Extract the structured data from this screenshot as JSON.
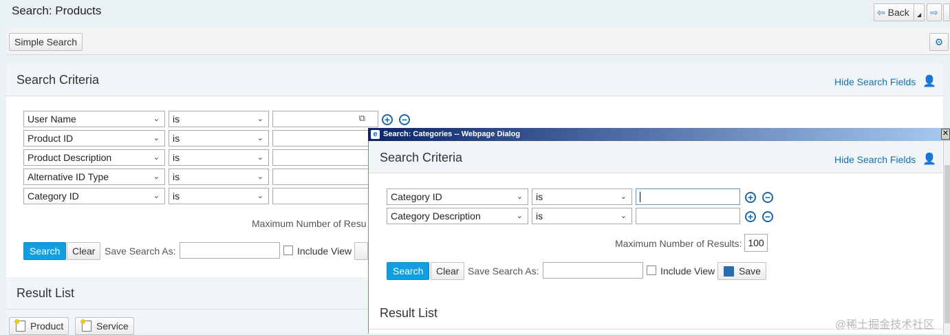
{
  "page": {
    "title": "Search: Products",
    "back_label": "Back",
    "simple_search_label": "Simple Search"
  },
  "search": {
    "header": "Search Criteria",
    "hide_fields": "Hide Search Fields",
    "rows": [
      {
        "field": "User Name",
        "op": "is"
      },
      {
        "field": "Product ID",
        "op": "is"
      },
      {
        "field": "Product Description",
        "op": "is"
      },
      {
        "field": "Alternative ID Type",
        "op": "is"
      },
      {
        "field": "Category ID",
        "op": "is"
      }
    ],
    "max_results_label": "Maximum Number of Resu",
    "search_btn": "Search",
    "clear_btn": "Clear",
    "save_as_label": "Save Search As:",
    "include_view": "Include View"
  },
  "results": {
    "header": "Result List",
    "product_btn": "Product",
    "service_btn": "Service"
  },
  "dialog": {
    "title": "Search: Categories -- Webpage Dialog",
    "header": "Search Criteria",
    "hide_fields": "Hide Search Fields",
    "rows": [
      {
        "field": "Category ID",
        "op": "is",
        "value": ""
      },
      {
        "field": "Category Description",
        "op": "is",
        "value": ""
      }
    ],
    "max_results_label": "Maximum Number of Results:",
    "max_results_value": "100",
    "search_btn": "Search",
    "clear_btn": "Clear",
    "save_as_label": "Save Search As:",
    "include_view": "Include View",
    "save_btn": "Save",
    "result_header": "Result List"
  },
  "watermark": "@稀土掘金技术社区"
}
